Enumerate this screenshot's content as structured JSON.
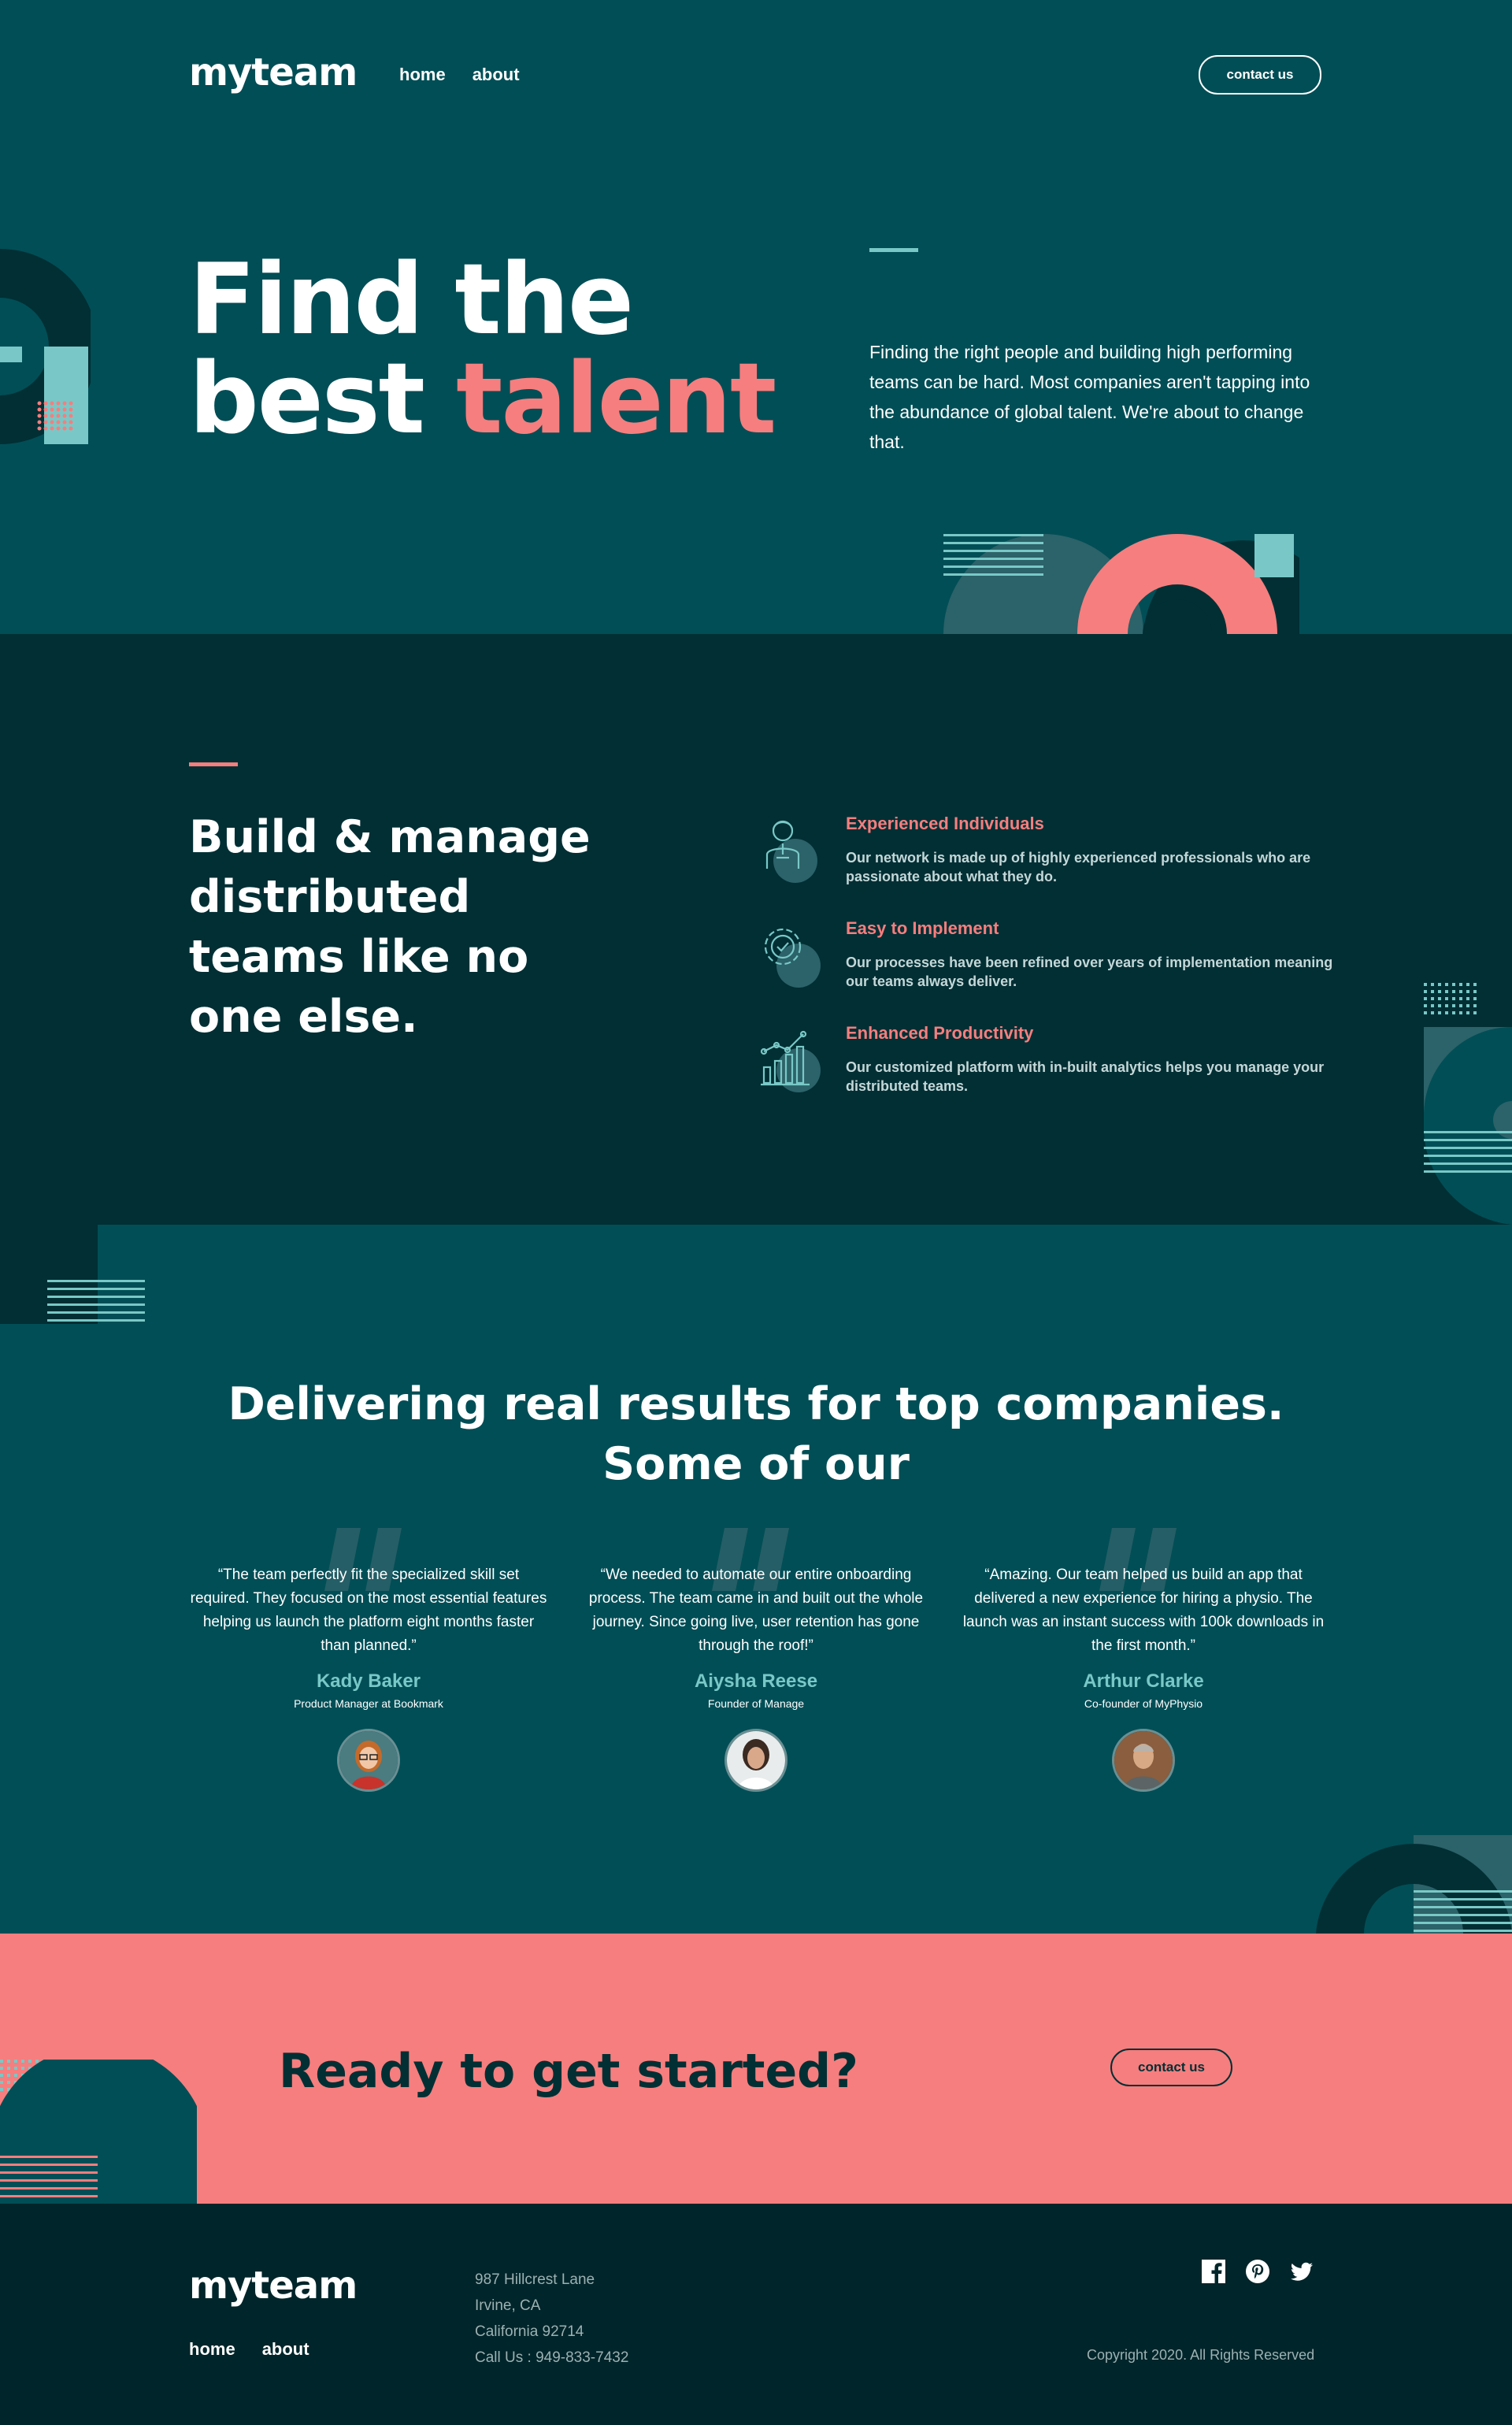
{
  "header": {
    "logo": "myteam",
    "nav": [
      "home",
      "about"
    ],
    "cta_label": "contact us"
  },
  "hero": {
    "title_line1": "Find the",
    "title_line2_plain": "best ",
    "title_line2_accent": "talent",
    "text": "Finding the right people and building high performing teams can be hard. Most companies aren't tapping into the abundance of global talent. We're about to change that."
  },
  "features": {
    "title": "Build & manage distributed teams like no one else.",
    "items": [
      {
        "icon": "person-icon",
        "title": "Experienced Individuals",
        "text": "Our network is made up of highly experienced professionals who are passionate about what they do."
      },
      {
        "icon": "cog-check-icon",
        "title": "Easy to Implement",
        "text": "Our processes have been refined over years of implementation meaning our teams always deliver."
      },
      {
        "icon": "chart-growth-icon",
        "title": "Enhanced Productivity",
        "text": "Our customized platform with in-built analytics helps you manage your distributed teams."
      }
    ]
  },
  "testimonials": {
    "title": "Delivering real results for top companies. Some of our",
    "items": [
      {
        "quote": "“The team perfectly fit the specialized skill set required. They focused on the most essential features helping us launch the platform eight months faster than planned.”",
        "name": "Kady Baker",
        "role": "Product Manager at Bookmark"
      },
      {
        "quote": "“We needed to automate our entire onboarding process. The team came in and built out the whole journey. Since going live, user retention has gone through the roof!”",
        "name": "Aiysha Reese",
        "role": "Founder of Manage"
      },
      {
        "quote": "“Amazing. Our team helped us build an app that delivered a new experience for hiring a physio. The launch was an instant success with 100k downloads in the first month.”",
        "name": "Arthur Clarke",
        "role": "Co-founder of MyPhysio"
      }
    ]
  },
  "cta": {
    "title": "Ready to get started?",
    "button": "contact us"
  },
  "footer": {
    "logo": "myteam",
    "nav": [
      "home",
      "about"
    ],
    "address": [
      "987 Hillcrest Lane",
      "Irvine, CA",
      "California 92714",
      "Call Us : 949-833-7432"
    ],
    "socials": [
      "facebook-icon",
      "pinterest-icon",
      "twitter-icon"
    ],
    "copyright": "Copyright 2020. All Rights Reserved"
  },
  "colors": {
    "midnight_green": "#014E56",
    "deep_jungle": "#012F34",
    "footer_bg": "#00252A",
    "coral": "#F67E7E",
    "rapture_blue": "#79C8C7",
    "white": "#FFFFFF"
  }
}
